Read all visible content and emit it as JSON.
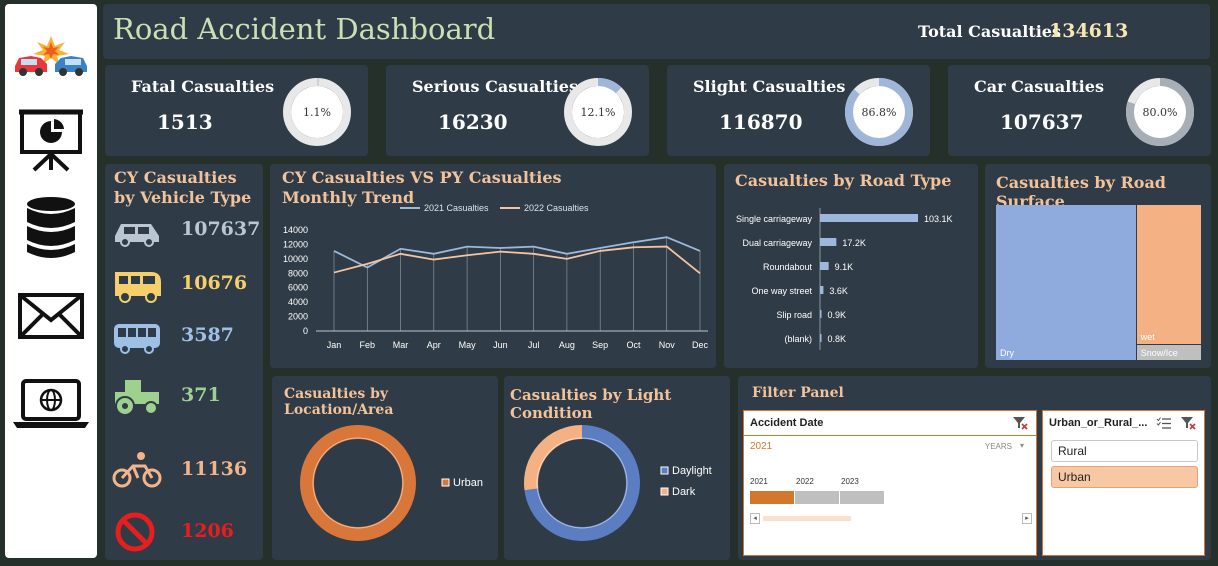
{
  "header": {
    "title": "Road Accident Dashboard",
    "total_label": "Total Casualties",
    "total_value": "134613"
  },
  "sidebar": {
    "icons": [
      "car-crash-icon",
      "presentation-icon",
      "database-icon",
      "mail-icon",
      "laptop-globe-icon"
    ]
  },
  "kpis": [
    {
      "label": "Fatal Casualties",
      "value": "1513",
      "pct_label": "1.1%",
      "pct": 1.1,
      "color": "#cfcfcf"
    },
    {
      "label": "Serious Casualties",
      "value": "16230",
      "pct_label": "12.1%",
      "pct": 12.1,
      "color": "#9fb6d8"
    },
    {
      "label": "Slight Casualties",
      "value": "116870",
      "pct_label": "86.8%",
      "pct": 86.8,
      "color": "#9fb6d8"
    },
    {
      "label": "Car Casualties",
      "value": "107637",
      "pct_label": "80.0%",
      "pct": 80.0,
      "color": "#a8aeb6"
    }
  ],
  "vehicle": {
    "title": "CY Casualties by Vehicle Type",
    "rows": [
      {
        "icon": "car-icon",
        "value": "107637",
        "color": "#bcc6d0"
      },
      {
        "icon": "bus-yellow-icon",
        "value": "10676",
        "color": "#f5d06a"
      },
      {
        "icon": "bus-blue-icon",
        "value": "3587",
        "color": "#9fc0e6"
      },
      {
        "icon": "tractor-icon",
        "value": "371",
        "color": "#9ed08e"
      },
      {
        "icon": "bicycle-icon",
        "value": "11136",
        "color": "#f2b48b"
      },
      {
        "icon": "no-entry-icon",
        "value": "1206",
        "color": "#e81d1d"
      }
    ]
  },
  "trend": {
    "title": "CY Casualties VS PY Casualties Monthly Trend",
    "chart_data": {
      "type": "line",
      "categories": [
        "Jan",
        "Feb",
        "Mar",
        "Apr",
        "May",
        "Jun",
        "Jul",
        "Aug",
        "Sep",
        "Oct",
        "Nov",
        "Dec"
      ],
      "series": [
        {
          "name": "2021 Casualties",
          "color": "#9db8dc",
          "values": [
            11100,
            8800,
            11400,
            10700,
            11700,
            11500,
            11700,
            10700,
            11500,
            12300,
            13000,
            11100
          ]
        },
        {
          "name": "2022 Casualties",
          "color": "#f3c4a2",
          "values": [
            8100,
            9300,
            10700,
            9900,
            10500,
            11000,
            10700,
            10000,
            11100,
            11600,
            11700,
            8000
          ]
        }
      ],
      "yticks": [
        "0",
        "2000",
        "4000",
        "6000",
        "8000",
        "10000",
        "12000",
        "14000"
      ],
      "ylim": [
        0,
        14000
      ]
    }
  },
  "road_type": {
    "title": "Casualties by Road Type",
    "chart_data": {
      "type": "bar",
      "categories": [
        "Single carriageway",
        "Dual carriageway",
        "Roundabout",
        "One way street",
        "Slip road",
        "(blank)"
      ],
      "values": [
        103.1,
        17.2,
        9.1,
        3.6,
        0.9,
        0.8
      ],
      "labels": [
        "103.1K",
        "17.2K",
        "9.1K",
        "3.6K",
        "0.9K",
        "0.8K"
      ],
      "color": "#9db8dc"
    }
  },
  "road_surface": {
    "title": "Casualties by Road Surface",
    "chart_data": {
      "type": "treemap",
      "categories": [
        "Dry",
        "wet",
        "Snow/Ice"
      ],
      "values": [
        92,
        38,
        4
      ],
      "colors": [
        "#8faadc",
        "#f4b183",
        "#bfbfbf"
      ]
    }
  },
  "location": {
    "title": "Casualties by Location/Area",
    "legend": [
      "Urban"
    ],
    "chart_data": {
      "type": "pie",
      "categories": [
        "Urban"
      ],
      "values": [
        100
      ],
      "colors": [
        "#d9773a"
      ]
    }
  },
  "light": {
    "title": "Casualties by Light Condition",
    "legend": [
      "Daylight",
      "Dark"
    ],
    "chart_data": {
      "type": "pie",
      "categories": [
        "Daylight",
        "Dark"
      ],
      "values": [
        73,
        27
      ],
      "colors": [
        "#5b7ec2",
        "#f4b183"
      ]
    }
  },
  "filter": {
    "title": "Filter Panel",
    "date": {
      "title": "Accident  Date",
      "selected": "2021",
      "level": "YEARS",
      "years": [
        "2021",
        "2022",
        "2023"
      ]
    },
    "area": {
      "title": "Urban_or_Rural_...",
      "options": [
        "Rural",
        "Urban"
      ]
    }
  }
}
